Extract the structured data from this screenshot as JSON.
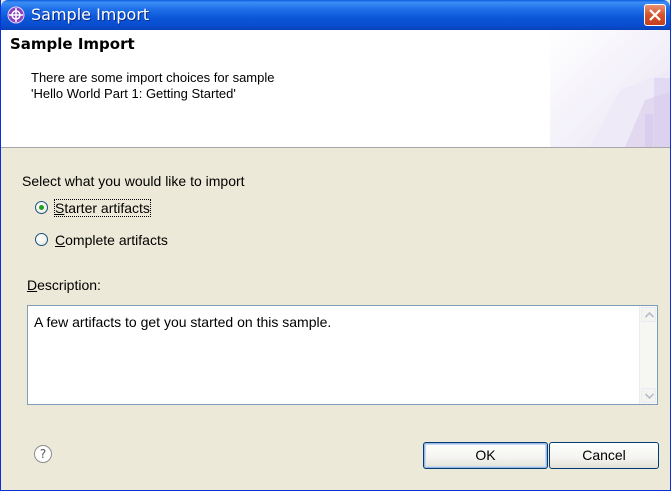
{
  "window": {
    "title": "Sample Import"
  },
  "banner": {
    "title": "Sample Import",
    "message": "There are some import choices for sample\n'Hello World Part 1: Getting Started'"
  },
  "import": {
    "section_label": "Select what you would like to import",
    "options": [
      {
        "mnemonic": "S",
        "rest": "tarter artifacts",
        "selected": true
      },
      {
        "mnemonic": "C",
        "rest": "omplete artifacts",
        "selected": false
      }
    ]
  },
  "description": {
    "label_mnemonic": "D",
    "label_rest": "escription:",
    "text": "A few artifacts to get you started on this sample."
  },
  "footer": {
    "help_glyph": "?",
    "ok_label": "OK",
    "cancel_label": "Cancel"
  },
  "colors": {
    "titlebar": "#0a5edc",
    "dialog_bg": "#ece9d8",
    "radio_dot": "#21a121",
    "close_button": "#d4532c"
  },
  "icons": {
    "app": "eclipse-app-icon",
    "close": "close-icon",
    "help": "help-icon",
    "scroll_up": "scroll-up-arrow-icon",
    "scroll_down": "scroll-down-arrow-icon"
  }
}
